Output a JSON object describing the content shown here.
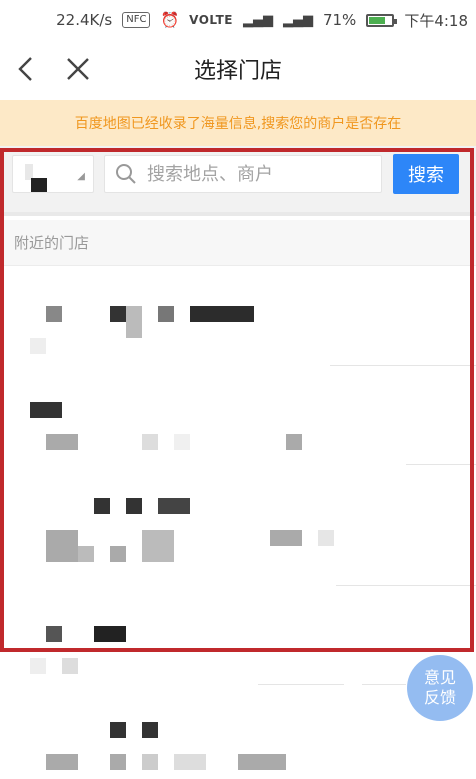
{
  "status_bar": {
    "speed": "22.4K/s",
    "nfc": "NFC",
    "alarm_icon": "alarm-clock-icon",
    "volte": "VOLTE",
    "signal_1": "4G",
    "signal_2": "2G",
    "battery_percent": "71%",
    "battery_level": 0.71,
    "time": "下午4:18"
  },
  "nav": {
    "back_icon": "chevron-left-icon",
    "close_icon": "close-icon",
    "title": "选择门店"
  },
  "notice": {
    "text": "百度地图已经收录了海量信息,搜索您的商户是否存在",
    "color": "#f0971f",
    "background": "#fde9c7"
  },
  "search": {
    "city_value": "",
    "placeholder": "搜索地点、商户",
    "button_label": "搜索",
    "accent": "#2d86f8"
  },
  "section": {
    "title": "附近的门店"
  },
  "stores": [
    {
      "name": "",
      "address": ""
    },
    {
      "name": "",
      "address": ""
    },
    {
      "name": "",
      "address": ""
    },
    {
      "name": "",
      "address": ""
    },
    {
      "name": "",
      "address": ""
    }
  ],
  "highlight": {
    "color": "#c0292c"
  },
  "feedback": {
    "line1": "意见",
    "line2": "反馈"
  }
}
